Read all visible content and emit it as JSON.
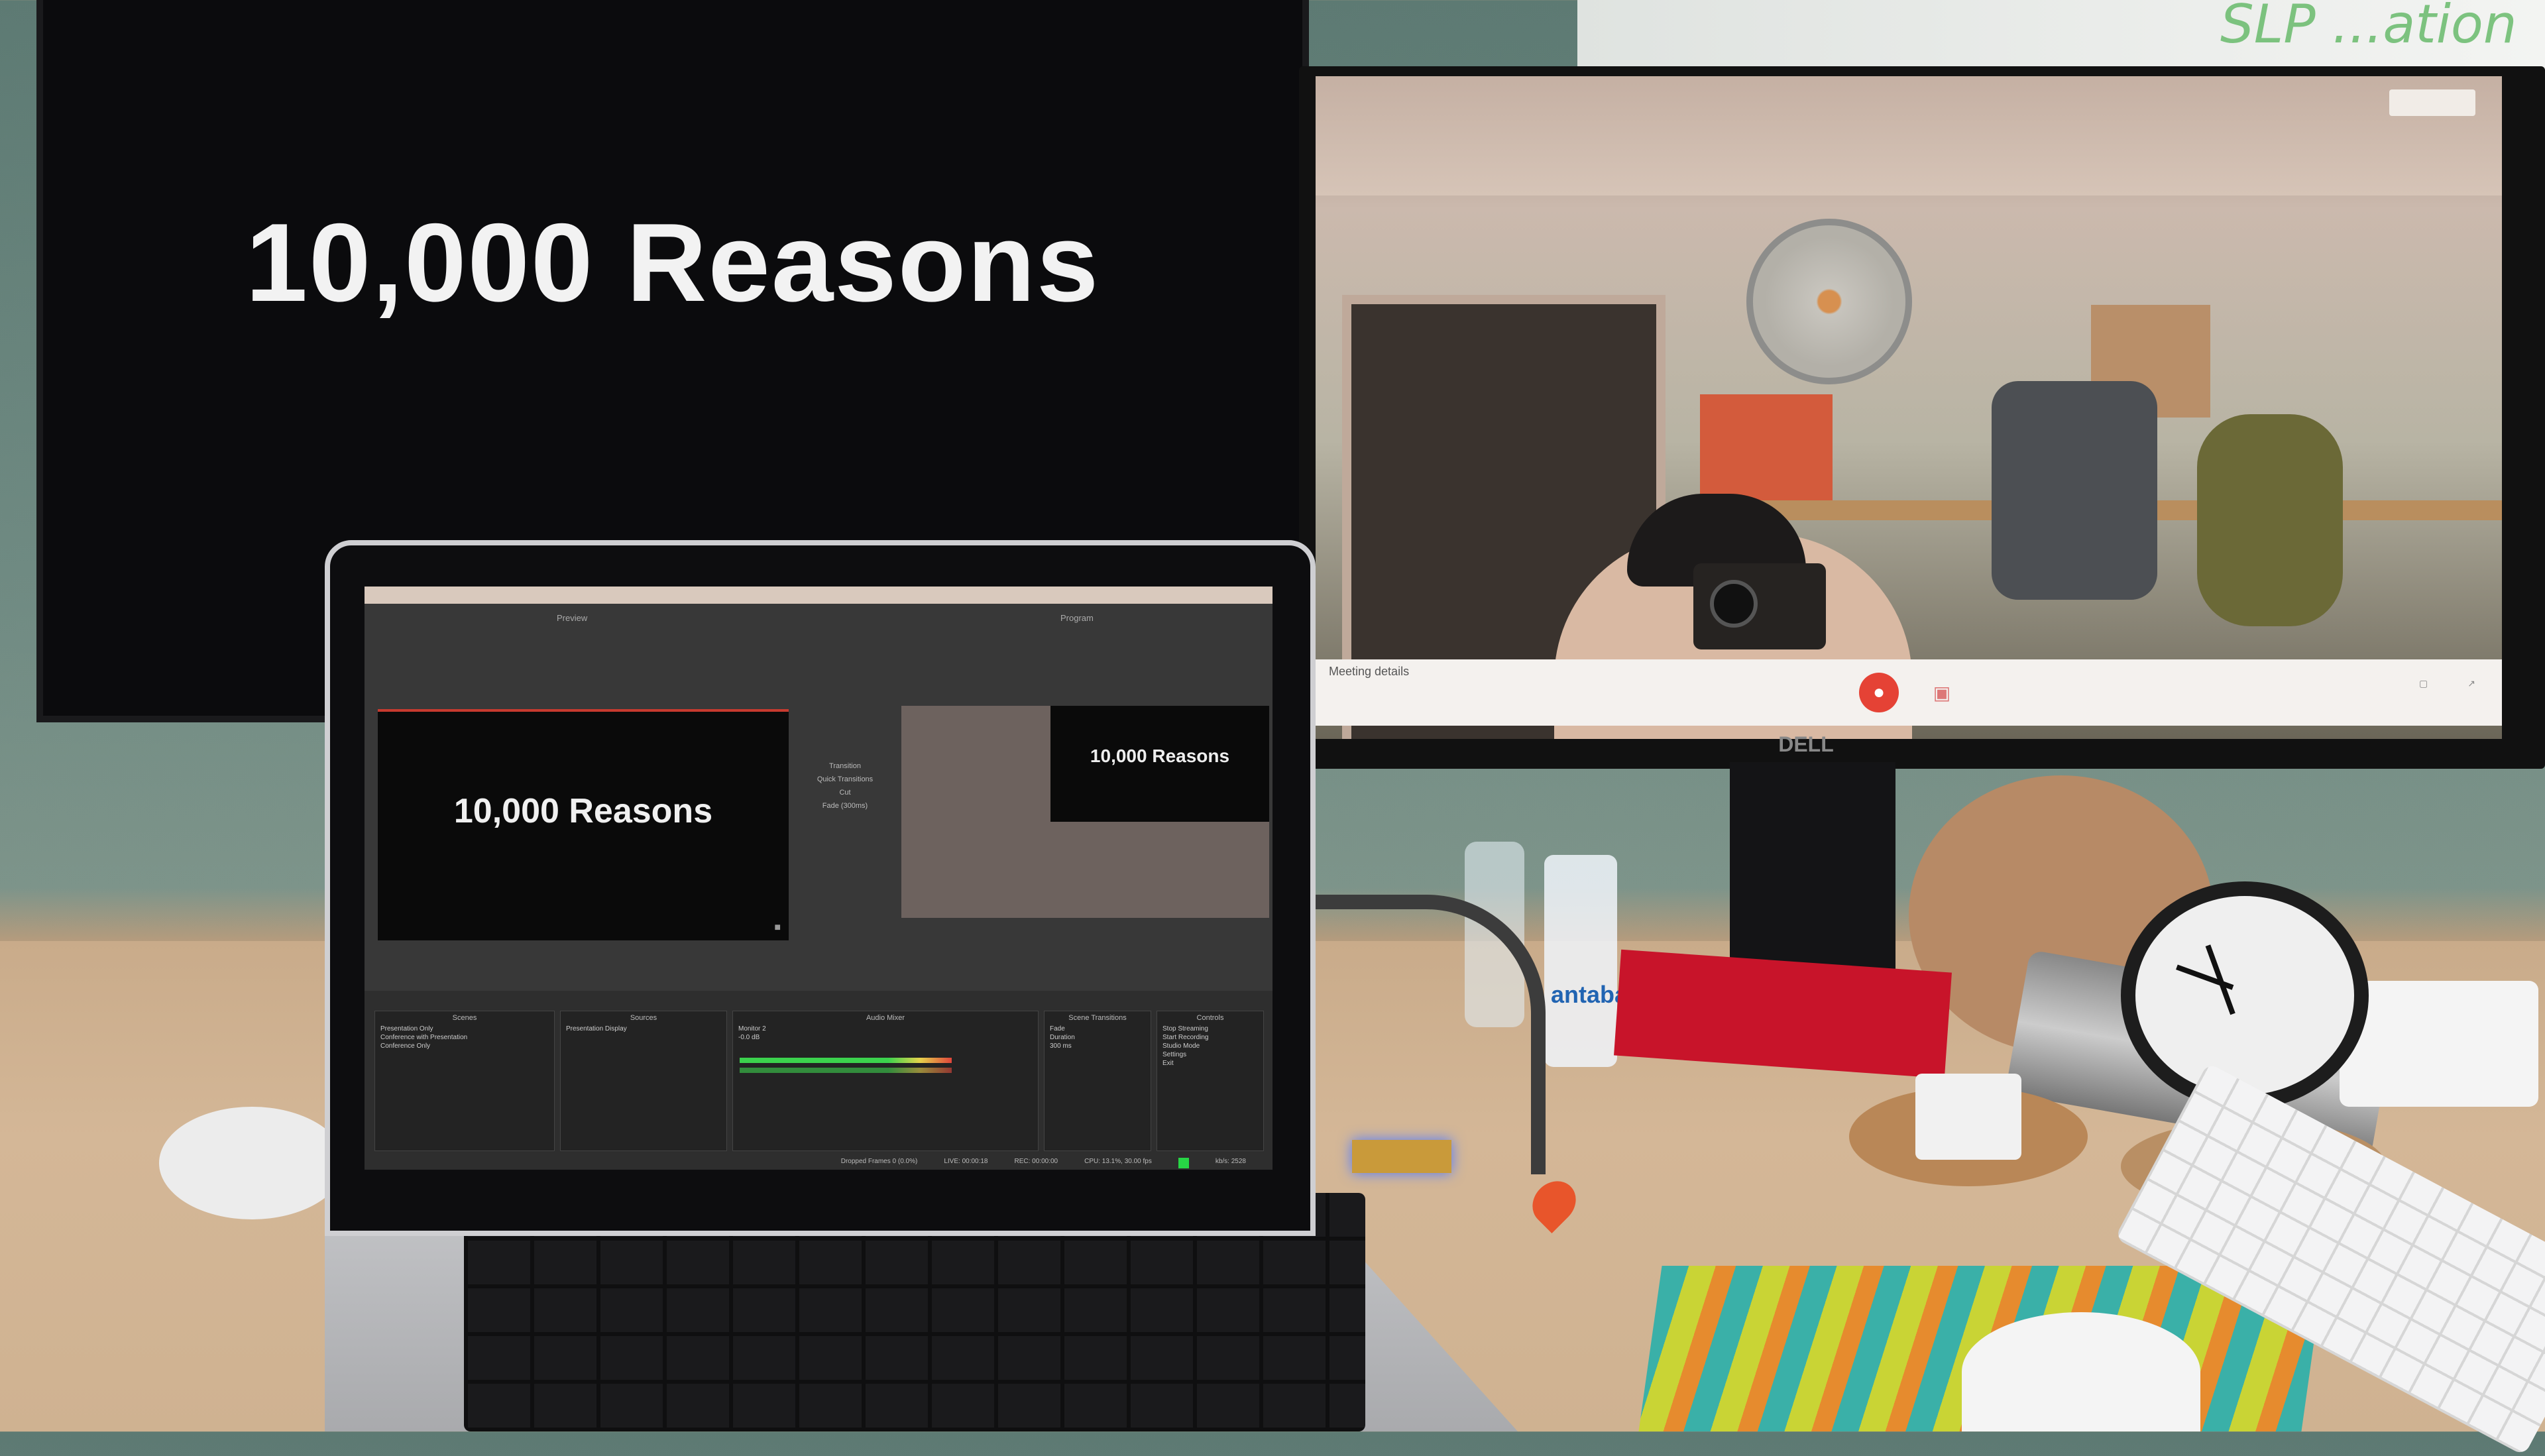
{
  "left_monitor": {
    "slide_title": "10,000 Reasons"
  },
  "whiteboard": {
    "text": "SLP ...ation"
  },
  "video_call": {
    "meeting_label": "Meeting details",
    "buttons": {
      "mic": "mic-off",
      "camera": "camera",
      "present": "present"
    }
  },
  "monitor_brand": "DELL",
  "laptop": {
    "obs": {
      "preview_label": "Preview",
      "program_label": "Program",
      "preview_title": "10,000 Reasons",
      "program_title": "10,000 Reasons",
      "transition_labels": [
        "Transition",
        "Quick Transitions",
        "Cut",
        "Fade (300ms)"
      ],
      "docks": {
        "scenes": {
          "header": "Scenes",
          "items": [
            "Presentation Only",
            "Conference with Presentation",
            "Conference Only"
          ]
        },
        "sources": {
          "header": "Sources",
          "items": [
            "Presentation Display"
          ]
        },
        "audio_mixer": {
          "header": "Audio Mixer",
          "track_name": "Monitor 2",
          "db_value": "-0.0 dB"
        },
        "scene_transitions": {
          "header": "Scene Transitions",
          "fade_label": "Fade",
          "duration_label": "Duration",
          "duration_value": "300 ms"
        },
        "controls": {
          "header": "Controls",
          "buttons": [
            "Stop Streaming",
            "Start Recording",
            "Studio Mode",
            "Settings",
            "Exit"
          ]
        }
      },
      "status": {
        "dropped_frames": "Dropped Frames 0 (0.0%)",
        "live": "LIVE: 00:00:18",
        "rec": "REC: 00:00:00",
        "cpu": "CPU: 13.1%, 30.00 fps",
        "kbps": "kb/s: 2528"
      },
      "colors": {
        "accent_red": "#c73a2f",
        "rec_green": "#27d645"
      }
    }
  },
  "bottle_label": "antaba"
}
